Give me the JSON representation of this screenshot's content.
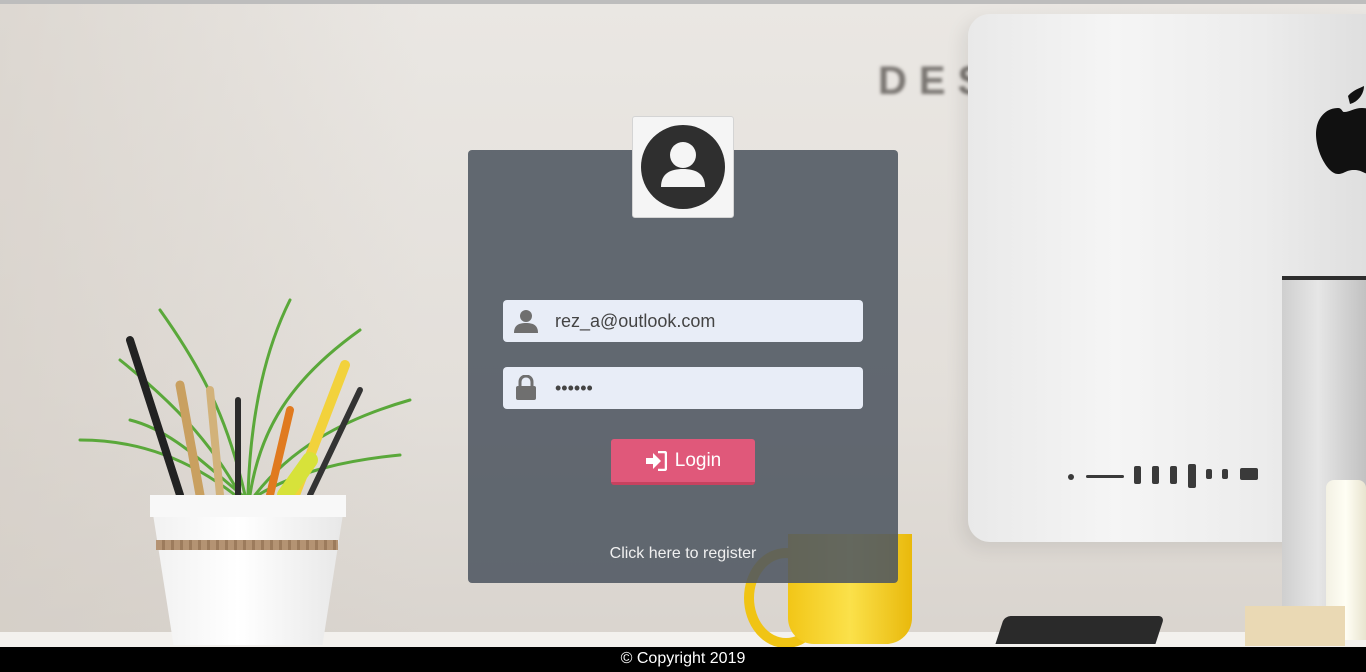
{
  "scene": {
    "wall_text": "DES"
  },
  "login": {
    "avatar_icon": "user-circle-icon",
    "email": {
      "icon": "user-icon",
      "value": "rez_a@outlook.com",
      "placeholder": ""
    },
    "password": {
      "icon": "lock-icon",
      "value": "••••••",
      "placeholder": ""
    },
    "button": {
      "icon": "sign-in-icon",
      "label": "Login"
    },
    "register_label": "Click here to register"
  },
  "footer": {
    "copyright": "© Copyright 2019"
  },
  "colors": {
    "panel": "#4f5661",
    "button": "#e0587a",
    "field": "#e8edf7",
    "footer": "#000000"
  }
}
